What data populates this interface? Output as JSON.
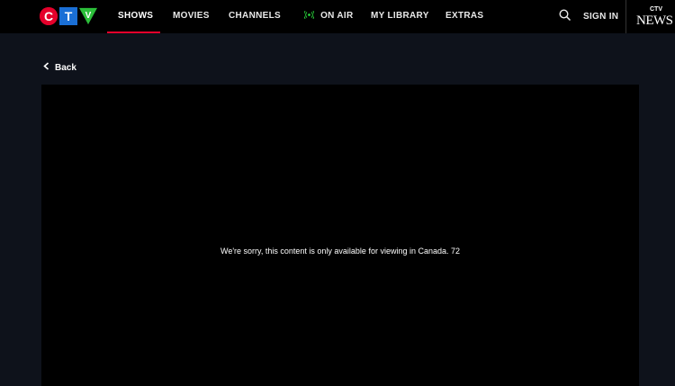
{
  "brand": {
    "logo_letters": [
      "C",
      "T",
      "V"
    ],
    "logo_colors": [
      "#e4002b",
      "#1a6fd6",
      "#2cbf3a"
    ],
    "accent": "#e4002b"
  },
  "nav": {
    "shows": "SHOWS",
    "movies": "MOVIES",
    "channels": "CHANNELS",
    "on_air": "ON AIR",
    "my_library": "MY LIBRARY",
    "extras": "EXTRAS",
    "active": "SHOWS",
    "on_air_icon": "broadcast-icon",
    "on_air_color": "#29d23a"
  },
  "header": {
    "search_icon": "search-icon",
    "sign_in": "SIGN IN",
    "partner_logo": {
      "top": "CTV",
      "bottom": "NEWS"
    }
  },
  "page": {
    "back_label": "Back",
    "back_icon": "chevron-left-icon",
    "player_message": "We're sorry, this content is only available for viewing in Canada. 72"
  }
}
